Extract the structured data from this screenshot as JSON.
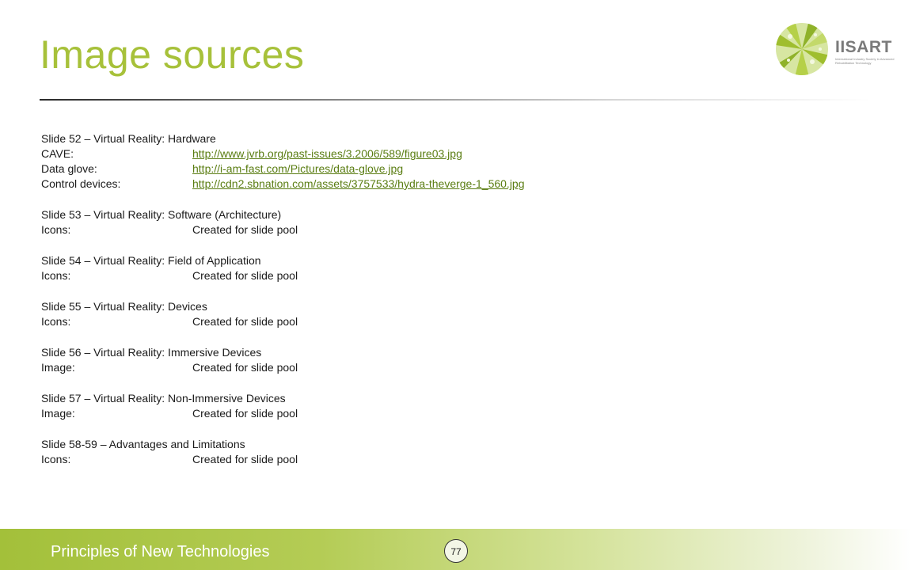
{
  "slide": {
    "title": "Image sources",
    "logo_text": "IISART",
    "logo_subtext": "International Industry Society in Advanced Rehabilitation Technology",
    "footer_title": "Principles of New Technologies",
    "page_number": "77"
  },
  "sections": [
    {
      "heading": "Slide 52 – Virtual Reality: Hardware",
      "rows": [
        {
          "label": "CAVE:",
          "value": "http://www.jvrb.org/past-issues/3.2006/589/figure03.jpg",
          "is_link": true
        },
        {
          "label": "Data glove:",
          "value": "http://i-am-fast.com/Pictures/data-glove.jpg",
          "is_link": true
        },
        {
          "label": "Control devices:",
          "value": "http://cdn2.sbnation.com/assets/3757533/hydra-theverge-1_560.jpg",
          "is_link": true
        }
      ]
    },
    {
      "heading": "Slide 53 – Virtual Reality: Software (Architecture)",
      "rows": [
        {
          "label": "Icons:",
          "value": "Created for slide pool",
          "is_link": false
        }
      ]
    },
    {
      "heading": "Slide 54 – Virtual Reality: Field of Application",
      "rows": [
        {
          "label": "Icons:",
          "value": "Created for slide pool",
          "is_link": false
        }
      ]
    },
    {
      "heading": "Slide 55 – Virtual Reality: Devices",
      "rows": [
        {
          "label": "Icons:",
          "value": "Created for slide pool",
          "is_link": false
        }
      ]
    },
    {
      "heading": "Slide 56 – Virtual Reality: Immersive Devices",
      "rows": [
        {
          "label": "Image:",
          "value": "Created for slide pool",
          "is_link": false
        }
      ]
    },
    {
      "heading": "Slide 57 – Virtual Reality: Non-Immersive Devices",
      "rows": [
        {
          "label": "Image:",
          "value": "Created for slide pool",
          "is_link": false
        }
      ]
    },
    {
      "heading": "Slide 58-59 – Advantages and Limitations",
      "rows": [
        {
          "label": "Icons:",
          "value": "Created for slide pool",
          "is_link": false
        }
      ]
    }
  ],
  "colors": {
    "accent": "#a7c13a",
    "link": "#5a7d12",
    "footer_start": "#a3c03a"
  },
  "icons": [
    "iisart-logo-icon"
  ]
}
